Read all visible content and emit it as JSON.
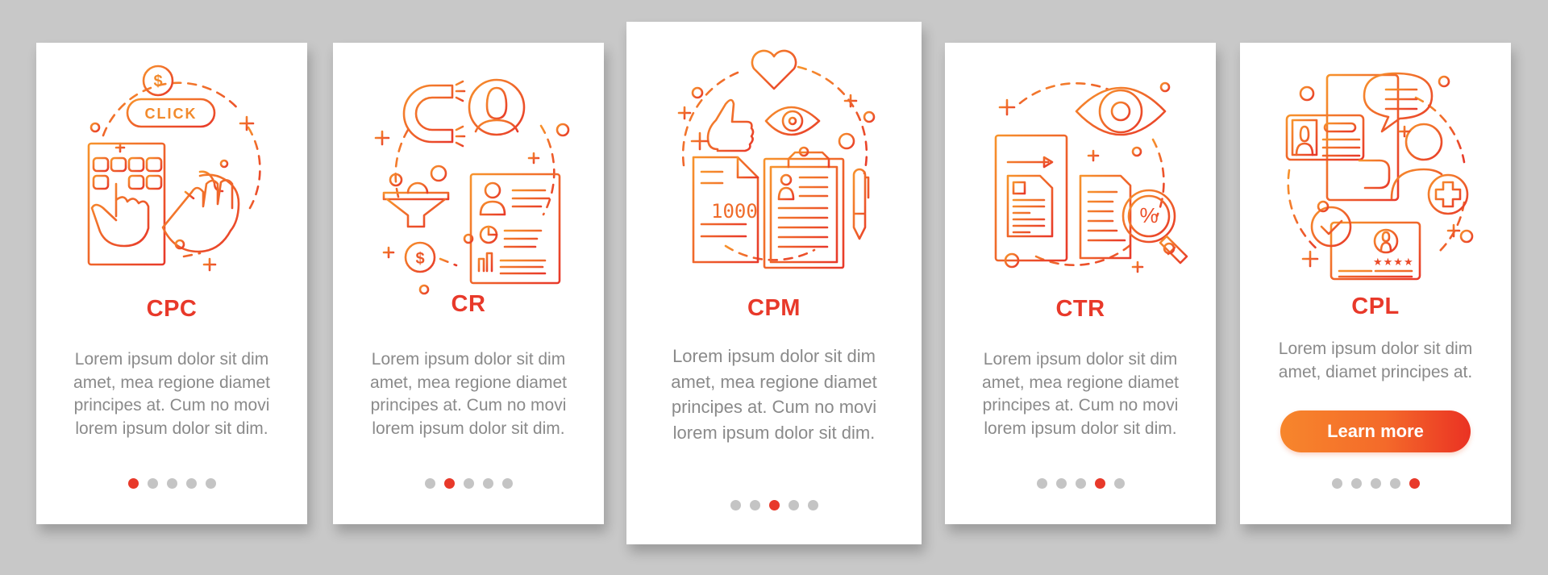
{
  "theme": {
    "accent": "#e8392a",
    "gradient_start": "#f7932c",
    "gradient_end": "#e8392a",
    "text_muted": "#8a8a8a",
    "dot_inactive": "#c4c4c4",
    "background": "#c8c8c8"
  },
  "screens": [
    {
      "title": "CPC",
      "icon": "pay-per-click-icon",
      "illustration_text": {
        "badge": "CLICK",
        "coin": "$"
      },
      "description": [
        "Lorem ipsum dolor sit dim",
        "amet, mea regione diamet",
        "principes at. Cum no movi",
        "lorem ipsum dolor sit dim."
      ],
      "active_page": 1,
      "total_pages": 5
    },
    {
      "title": "CR",
      "icon": "conversion-rate-icon",
      "illustration_text": {
        "coin": "$"
      },
      "description": [
        "Lorem ipsum dolor sit dim",
        "amet, mea regione diamet",
        "principes at. Cum no movi",
        "lorem ipsum dolor sit dim."
      ],
      "active_page": 2,
      "total_pages": 5
    },
    {
      "title": "CPM",
      "icon": "cost-per-mille-icon",
      "illustration_text": {
        "document_number": "1000"
      },
      "description": [
        "Lorem ipsum dolor sit dim",
        "amet, mea regione diamet",
        "principes at. Cum no movi",
        "lorem ipsum dolor sit dim."
      ],
      "active_page": 3,
      "total_pages": 5
    },
    {
      "title": "CTR",
      "icon": "click-through-rate-icon",
      "illustration_text": {
        "magnifier": "%"
      },
      "description": [
        "Lorem ipsum dolor sit dim",
        "amet, mea regione diamet",
        "principes at. Cum no movi",
        "lorem ipsum dolor sit dim."
      ],
      "active_page": 4,
      "total_pages": 5
    },
    {
      "title": "CPL",
      "icon": "cost-per-lead-icon",
      "illustration_text": {},
      "description": [
        "Lorem ipsum dolor sit dim",
        "amet, diamet principes at."
      ],
      "button_label": "Learn more",
      "active_page": 5,
      "total_pages": 5
    }
  ]
}
